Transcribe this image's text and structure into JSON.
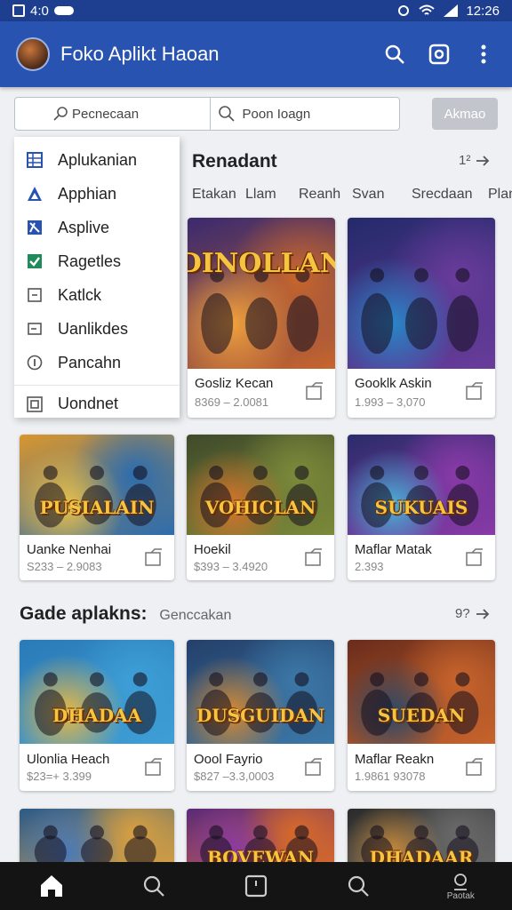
{
  "status_bar": {
    "left_text": "4:0",
    "time": "12:26"
  },
  "app_bar": {
    "title": "Foko Aplikt Haoan",
    "icons": [
      "search-icon",
      "camera-icon",
      "more-vert-icon"
    ]
  },
  "search": {
    "field1": "Pecnecaan",
    "field2": "Poon Ioagn",
    "button": "Akmao"
  },
  "dropdown": {
    "items": [
      {
        "label": "Aplukanian",
        "icon": "grid-icon"
      },
      {
        "label": "Apphian",
        "icon": "triangle-icon"
      },
      {
        "label": "Asplive",
        "icon": "compass-icon"
      },
      {
        "label": "Ragetles",
        "icon": "check-icon"
      },
      {
        "label": "Katlck",
        "icon": "box-icon"
      },
      {
        "label": "Uanlikdes",
        "icon": "minus-box-icon"
      },
      {
        "label": "Pancahn",
        "icon": "info-icon"
      },
      {
        "label": "Uondnet",
        "icon": "square-icon"
      }
    ]
  },
  "section1": {
    "title": "Renadant",
    "more": "1²",
    "tabs": [
      "Etakan",
      "Llam",
      "Reanh",
      "Svan",
      "Srecdaan",
      "Plan"
    ]
  },
  "cards_row1": [
    {
      "title": "Gosliz Kecan",
      "price": "8369 – 2.0081",
      "logo": "DINOLLAN",
      "colors": [
        "#3a2a6e",
        "#c8662c",
        "#f2a23c"
      ]
    },
    {
      "title": "Gooklk Askin",
      "price": "1.993 – 3,070",
      "logo": "",
      "colors": [
        "#242a6a",
        "#6a3c9c",
        "#2a86c9"
      ]
    }
  ],
  "cards_row2": [
    {
      "title": "Uanke Nenhai",
      "price": "S233 – 2.9083",
      "logo": "PUSIALAIN",
      "colors": [
        "#d8962e",
        "#2c6cae",
        "#e7c14c"
      ]
    },
    {
      "title": "Hoekil",
      "price": "$393 – 3.4920",
      "logo": "VOHICLAN",
      "colors": [
        "#3f4a2a",
        "#7c8a3a",
        "#d9742a"
      ]
    },
    {
      "title": "Maflar Matak",
      "price": "2.393",
      "logo": "SUKUAIS",
      "colors": [
        "#2a2c6a",
        "#8a3aa8",
        "#4ab0d8"
      ]
    }
  ],
  "section2": {
    "title": "Gade aplakns:",
    "subtitle": "Genccakan",
    "more": "9?"
  },
  "cards_row3": [
    {
      "title": "Ulonlia Heach",
      "price": "$23=+ 3.399",
      "logo": "DHADAA",
      "colors": [
        "#2a7ab8",
        "#3e9fd6",
        "#e8b844"
      ]
    },
    {
      "title": "Oool Fayrio",
      "price": "$827 –3.3,0003",
      "logo": "DUSGUIDAN",
      "colors": [
        "#24406a",
        "#3c78a8",
        "#d88a30"
      ]
    },
    {
      "title": "Maflar Reakn",
      "price": "1.9861 93078",
      "logo": "SUEDAN",
      "colors": [
        "#6a2c1c",
        "#c8642c",
        "#2a4a6a"
      ]
    }
  ],
  "cards_row4": [
    {
      "logo": "",
      "colors": [
        "#2a5a8a",
        "#d8a040",
        "#4a7ab8"
      ]
    },
    {
      "logo": "BOVEWAN",
      "colors": [
        "#5a2a7a",
        "#d86a2a",
        "#8a3aa8"
      ]
    },
    {
      "logo": "DHADAAR",
      "colors": [
        "#2a2a2a",
        "#6a6a6a",
        "#c88a3a"
      ]
    }
  ],
  "bottom_nav": {
    "items": [
      "home-icon",
      "search-icon",
      "square-icon",
      "search-icon-2",
      "profile-icon"
    ],
    "last_label": "Paotak"
  }
}
